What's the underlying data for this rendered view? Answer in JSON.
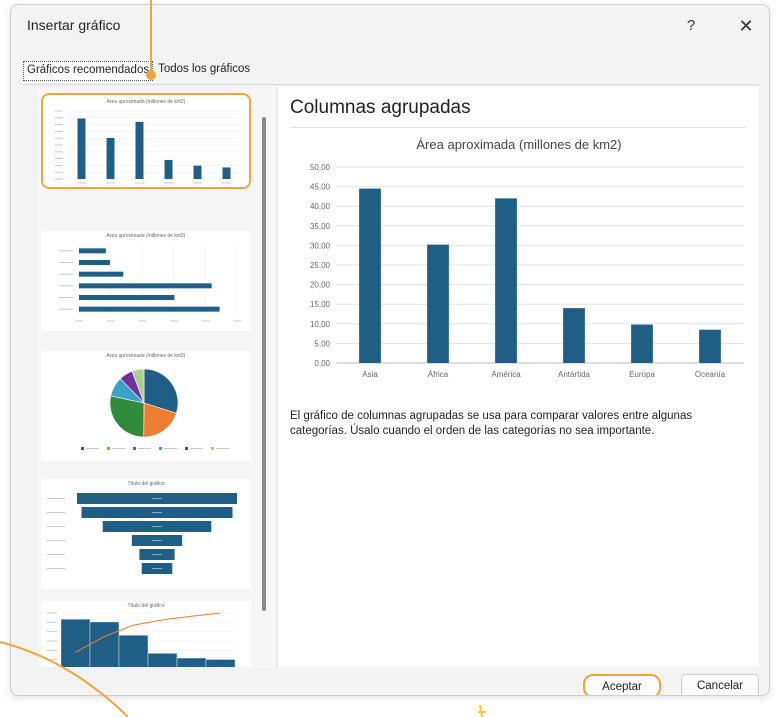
{
  "window": {
    "title": "Insertar gráfico",
    "help_label": "?",
    "close_label": "✕"
  },
  "tabs": [
    {
      "label": "Gráficos recomendados",
      "active": true
    },
    {
      "label": "Todos los gráficos",
      "active": false
    }
  ],
  "preview": {
    "heading": "Columnas agrupadas",
    "description": "El gráfico de columnas agrupadas se usa para comparar valores entre algunas categorías. Úsalo cuando el orden de las categorías no sea importante."
  },
  "buttons": {
    "accept": "Aceptar",
    "cancel": "Cancelar"
  },
  "colors": {
    "bar": "#1f5f86",
    "accent": "#f0a43a",
    "pie": [
      "#1f5f86",
      "#ed7d31",
      "#2e8b3b",
      "#3aa0c8",
      "#7030a0",
      "#a9d18e"
    ]
  },
  "chart_data": {
    "type": "bar",
    "title": "Área aproximada (millones de km2)",
    "categories": [
      "Asia",
      "África",
      "América",
      "Antártida",
      "Europa",
      "Oceanía"
    ],
    "values": [
      44.5,
      30.2,
      42.0,
      14.0,
      9.8,
      8.5
    ],
    "ylim": [
      0,
      50
    ],
    "yticks": [
      "0,00",
      "5,00",
      "10,00",
      "15,00",
      "20,00",
      "25,00",
      "30,00",
      "35,00",
      "40,00",
      "45,00",
      "50,00"
    ],
    "grid": true,
    "xlabel": "",
    "ylabel": ""
  },
  "thumbnails": [
    {
      "type": "column",
      "selected": true,
      "title": "Área aproximada (millones de km2)"
    },
    {
      "type": "bar",
      "selected": false,
      "title": "Área aproximada (millones de km2)"
    },
    {
      "type": "pie",
      "selected": false,
      "title": "Área aproximada (millones de km2)"
    },
    {
      "type": "funnel",
      "selected": false,
      "title": "Título del gráfico"
    },
    {
      "type": "pareto",
      "selected": false,
      "title": "Título del gráfico"
    }
  ]
}
